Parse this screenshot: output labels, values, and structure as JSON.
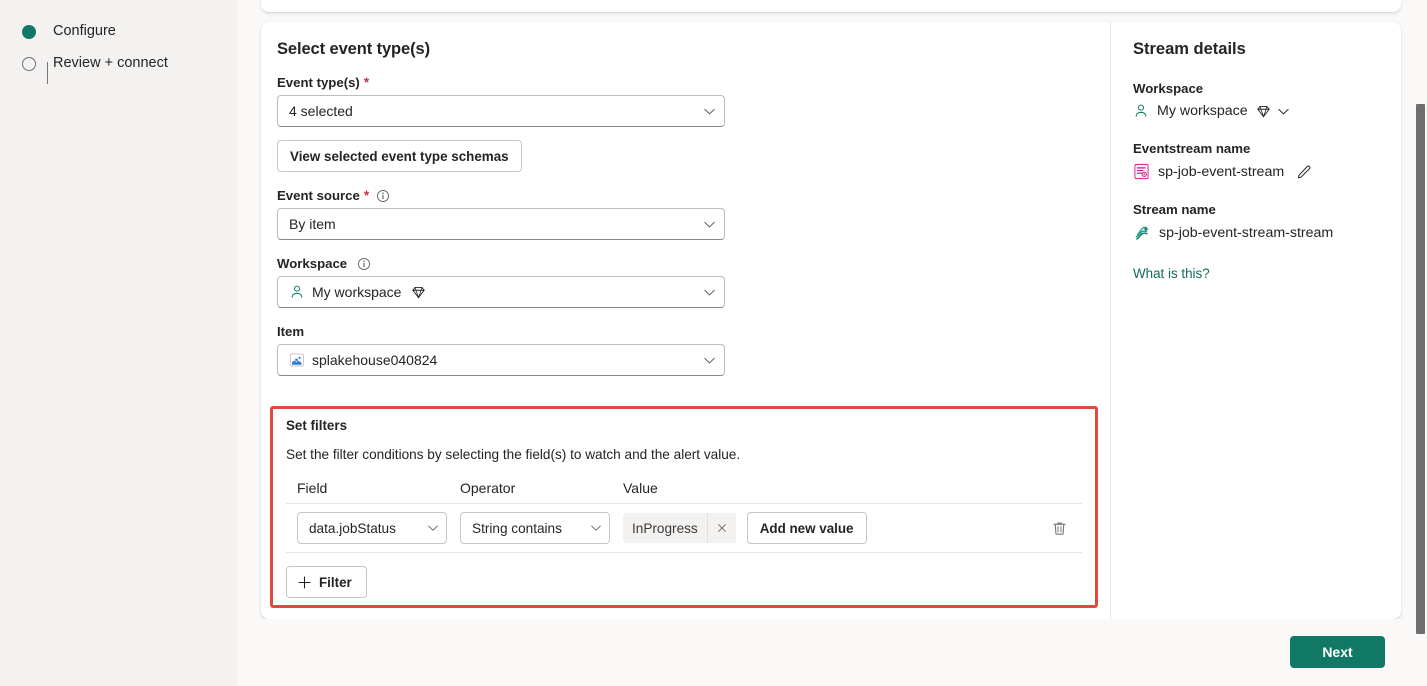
{
  "steps": [
    {
      "label": "Configure",
      "state": "active",
      "marker": "filled-dot-icon"
    },
    {
      "label": "Review + connect",
      "state": "pending",
      "marker": "hollow-dot-icon"
    }
  ],
  "main": {
    "section_title": "Select event type(s)",
    "fields": [
      {
        "label": "Event type(s)",
        "required": "*",
        "has_info": false,
        "value": "4 selected",
        "icon": ""
      },
      {
        "label": "Event source",
        "required": "*",
        "has_info": true,
        "value": "By item",
        "icon": ""
      },
      {
        "label": "Workspace",
        "required": "",
        "has_info": true,
        "value": "My workspace",
        "icon": "person-icon",
        "badge": "diamond-icon"
      },
      {
        "label": "Item",
        "required": "",
        "has_info": false,
        "value": "splakehouse040824",
        "icon": "lakehouse-icon"
      }
    ],
    "view_schemas_button": "View selected event type schemas"
  },
  "filters": {
    "title": "Set filters",
    "description": "Set the filter conditions by selecting the field(s) to watch and the alert value.",
    "columns": [
      "Field",
      "Operator",
      "Value"
    ],
    "rows": [
      {
        "field": "data.jobStatus",
        "operator": "String contains",
        "values": [
          "InProgress"
        ],
        "add_value_label": "Add new value",
        "delete_icon": "trash-icon"
      }
    ],
    "add_filter_label": "Filter",
    "add_filter_icon": "plus-icon",
    "highlight_color": "#e24a3b"
  },
  "stream_details": {
    "title": "Stream details",
    "groups": [
      {
        "label": "Workspace",
        "value": "My workspace",
        "icon": "person-icon",
        "badge": "diamond-icon",
        "chevron": "chevron-down-icon"
      },
      {
        "label": "Eventstream name",
        "value": "sp-job-event-stream",
        "icon": "eventstream-icon",
        "action_icon": "pencil-icon"
      },
      {
        "label": "Stream name",
        "value": "sp-job-event-stream-stream",
        "icon": "stream-icon"
      }
    ],
    "help_link": "What is this?"
  },
  "footer": {
    "next_label": "Next"
  },
  "colors": {
    "accent": "#117865",
    "link": "#0f6c5c",
    "required": "#c4314b",
    "highlight": "#e24a3b",
    "eventstream_icon": "#d6168c",
    "lakehouse_icon": "#2b7cd3"
  }
}
